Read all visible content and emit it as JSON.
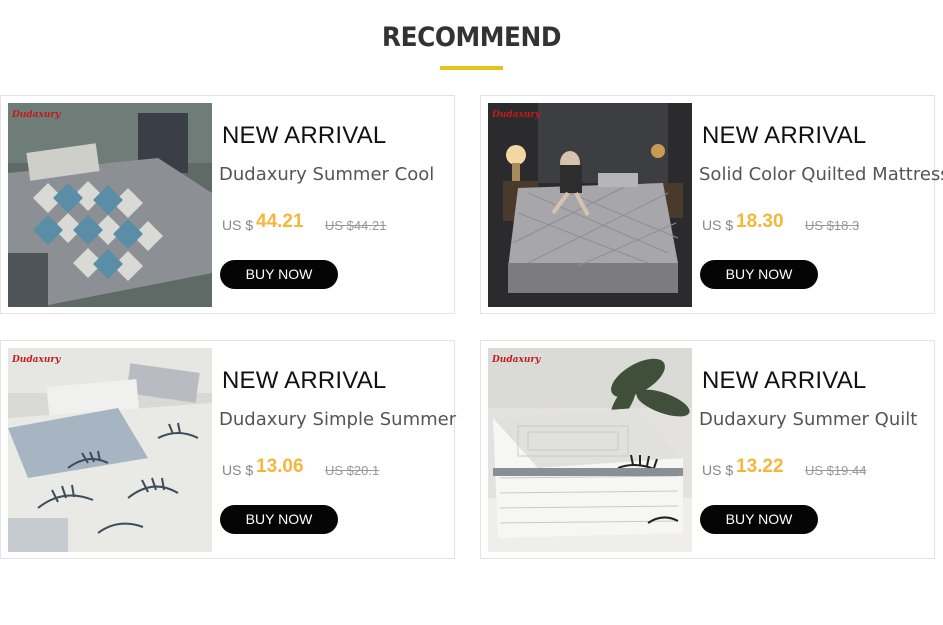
{
  "section": {
    "title": "RECOMMEND",
    "accent_color": "#e6c21f"
  },
  "products": [
    {
      "brand": "Dudaxury",
      "badge": "NEW ARRIVAL",
      "name": "Dudaxury Summer Cool",
      "currency": "US $",
      "price": "44.21",
      "old_price": "US $44.21",
      "button": "BUY NOW",
      "image": "argyle-bed-image"
    },
    {
      "brand": "Dudaxury",
      "badge": "NEW ARRIVAL",
      "name": "Solid Color Quilted Mattress",
      "currency": "US $",
      "price": "18.30",
      "old_price": "US $18.3",
      "button": "BUY NOW",
      "image": "quilted-mattress-image"
    },
    {
      "brand": "Dudaxury",
      "badge": "NEW ARRIVAL",
      "name": "Dudaxury Simple Summer",
      "currency": "US $",
      "price": "13.06",
      "old_price": "US $20.1",
      "button": "BUY NOW",
      "image": "leaf-quilt-bed-image"
    },
    {
      "brand": "Dudaxury",
      "badge": "NEW ARRIVAL",
      "name": "Dudaxury Summer Quilt",
      "currency": "US $",
      "price": "13.22",
      "old_price": "US $19.44",
      "button": "BUY NOW",
      "image": "folded-quilt-image"
    }
  ],
  "colors": {
    "price": "#f4b73a",
    "button_bg": "#050505",
    "button_text": "#ffffff",
    "brand_logo": "#c21b1b"
  }
}
